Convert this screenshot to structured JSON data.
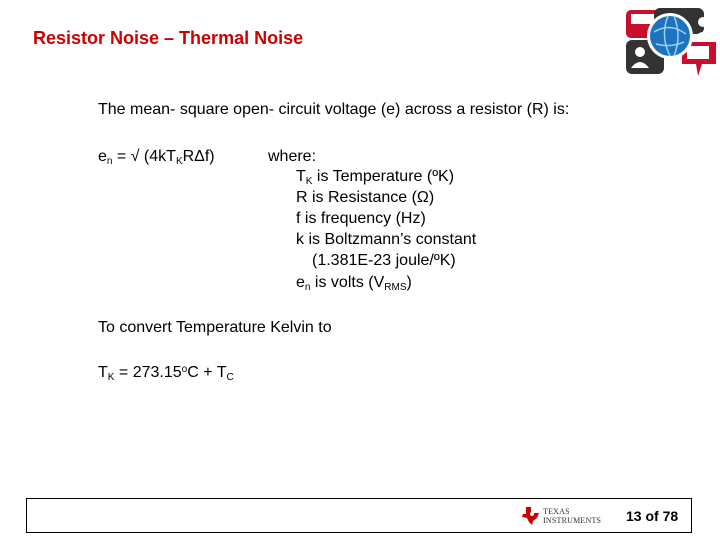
{
  "slide": {
    "title": "Resistor Noise – Thermal Noise",
    "intro": "The mean- square open- circuit voltage (e) across a resistor (R) is:",
    "formula": {
      "lhs_base": "e",
      "lhs_sub": "n",
      "eq_prefix": " = √ (4kT",
      "t_sub": "K",
      "eq_suffix": "RΔf)"
    },
    "where_label": "where:",
    "definitions": [
      {
        "base": "T",
        "sub": "K",
        "text": " is Temperature (ºK)"
      },
      {
        "base": "",
        "sub": "",
        "text": "R is Resistance (Ω)"
      },
      {
        "base": "",
        "sub": "",
        "text": "f is frequency (Hz)"
      },
      {
        "base": "",
        "sub": "",
        "text": "k is Boltzmann’s constant"
      },
      {
        "base": "",
        "sub": "",
        "text": "(1.381E-23 joule/ºK)"
      },
      {
        "base": "e",
        "sub": "n",
        "text": " is volts (V",
        "sub2": "RMS",
        "tail": ")"
      }
    ],
    "convert_text": "To convert Temperature Kelvin to",
    "conversion": {
      "lhs_base": "T",
      "lhs_sub": "K",
      "mid": " = 273.15",
      "degree": "o",
      "mid2": "C + T",
      "rhs_sub": "C"
    }
  },
  "footer": {
    "brand_line1": "TEXAS",
    "brand_line2": "INSTRUMENTS",
    "page_label": "13 of 78"
  },
  "colors": {
    "title": "#cc0000",
    "ti_red": "#cc0000",
    "globe": "#1e73be"
  },
  "icons": {
    "header_logo": "communication-globe-icon",
    "ti_logo": "texas-instruments-logo"
  }
}
